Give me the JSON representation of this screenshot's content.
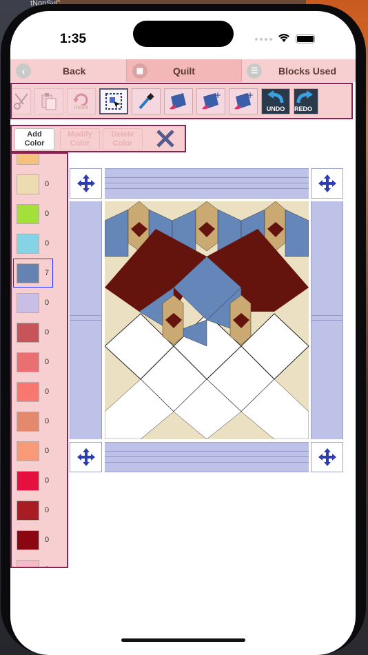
{
  "background": {
    "corner_text_1": "tNonSyC",
    "corner_text_2": "stor"
  },
  "status_bar": {
    "time": "1:35",
    "wifi_icon": "wifi-icon",
    "battery_icon": "battery-icon"
  },
  "nav": {
    "back_label": "Back",
    "quilt_label": "Quilt",
    "blocks_used_label": "Blocks Used"
  },
  "toolbar": {
    "rotate_label": "Rotate",
    "undo_label": "UNDO",
    "redo_label": "REDO",
    "icons": [
      "scissors-icon",
      "paste-icon",
      "rotate-icon",
      "select-block-icon",
      "eyedropper-icon",
      "fabric-paint-icon",
      "fabric-add-icon",
      "fabric-add-sparkle-icon",
      "undo-icon",
      "redo-icon"
    ]
  },
  "color_bar": {
    "add_color_label": "Add\nColor",
    "modify_color_label": "Modify\nColor",
    "delete_color_label": "Delete\nColor",
    "close_label": "✕"
  },
  "palette": {
    "selected_index": 3,
    "swatches": [
      {
        "color": "#f4c27a",
        "count": ""
      },
      {
        "color": "#ecdcb0",
        "count": "0"
      },
      {
        "color": "#a4e03a",
        "count": "0"
      },
      {
        "color": "#86d3e6",
        "count": "0"
      },
      {
        "color": "#6583b2",
        "count": "7"
      },
      {
        "color": "#c9bfe6",
        "count": "0"
      },
      {
        "color": "#c65458",
        "count": "0"
      },
      {
        "color": "#ea6f72",
        "count": "0"
      },
      {
        "color": "#f87870",
        "count": "0"
      },
      {
        "color": "#e4896c",
        "count": "0"
      },
      {
        "color": "#f89a78",
        "count": "0"
      },
      {
        "color": "#e5103d",
        "count": "0"
      },
      {
        "color": "#a81c24",
        "count": "0"
      },
      {
        "color": "#8a0611",
        "count": "0"
      },
      {
        "color": "#f5b9c8",
        "count": "0"
      }
    ]
  },
  "quilt": {
    "colors": {
      "bg": "#ebe1c2",
      "dark_red": "#64130d",
      "blue": "#6586b9",
      "tan": "#caa973",
      "white": "#ffffff",
      "border_lavender": "#bfc2e8"
    }
  }
}
